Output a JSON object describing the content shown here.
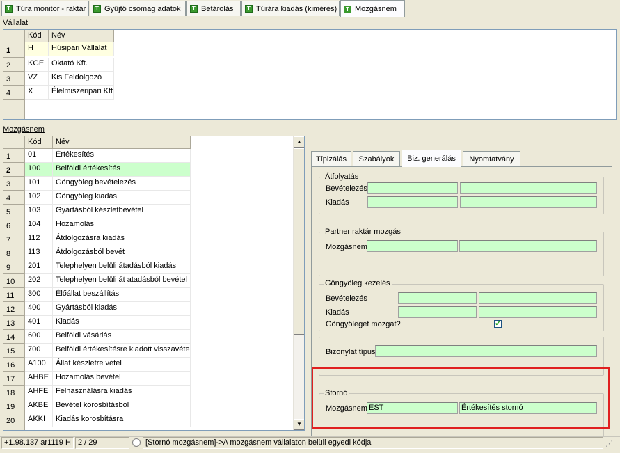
{
  "tabs": [
    {
      "label": "Túra monitor - raktár"
    },
    {
      "label": "Gyűjtő csomag adatok"
    },
    {
      "label": "Betárolás"
    },
    {
      "label": "Túrára kiadás (kimérés)"
    },
    {
      "label": "Mozgásnem"
    }
  ],
  "tab_icon_glyph": "T",
  "vallalat": {
    "label": "Vállalat",
    "headers": [
      "Kód",
      "Név"
    ],
    "rows": [
      {
        "num": "1",
        "kod": "H",
        "nev": "Húsipari Vállalat"
      },
      {
        "num": "2",
        "kod": "KGE",
        "nev": "Oktató Kft."
      },
      {
        "num": "3",
        "kod": "VZ",
        "nev": "Kis Feldolgozó"
      },
      {
        "num": "4",
        "kod": "X",
        "nev": "Élelmiszeripari Kft."
      }
    ]
  },
  "mozgasnem": {
    "label": "Mozgásnem",
    "headers": [
      "Kód",
      "Név"
    ],
    "rows": [
      {
        "num": "1",
        "kod": "01",
        "nev": "Értékesítés"
      },
      {
        "num": "2",
        "kod": "100",
        "nev": "Belföldi értékesítés"
      },
      {
        "num": "3",
        "kod": "101",
        "nev": "Göngyöleg bevételezés"
      },
      {
        "num": "4",
        "kod": "102",
        "nev": "Göngyöleg  kiadás"
      },
      {
        "num": "5",
        "kod": "103",
        "nev": "Gyártásból készletbevétel"
      },
      {
        "num": "6",
        "kod": "104",
        "nev": "Hozamolás"
      },
      {
        "num": "7",
        "kod": "112",
        "nev": "Átdolgozásra kiadás"
      },
      {
        "num": "8",
        "kod": "113",
        "nev": "Átdolgozásból bevét"
      },
      {
        "num": "9",
        "kod": "201",
        "nev": "Telephelyen belüli átadásból kiadás"
      },
      {
        "num": "10",
        "kod": "202",
        "nev": "Telephelyen belüli át atadásból bevétel"
      },
      {
        "num": "11",
        "kod": "300",
        "nev": "Élőállat beszállítás"
      },
      {
        "num": "12",
        "kod": "400",
        "nev": "Gyártásból kiadás"
      },
      {
        "num": "13",
        "kod": "401",
        "nev": "Kiadás"
      },
      {
        "num": "14",
        "kod": "600",
        "nev": "Belföldi vásárlás"
      },
      {
        "num": "15",
        "kod": "700",
        "nev": "Belföldi értékesítésre kiadott visszavétel"
      },
      {
        "num": "16",
        "kod": "A100",
        "nev": "Állat készletre vétel"
      },
      {
        "num": "17",
        "kod": "AHBE",
        "nev": "Hozamolás bevétel"
      },
      {
        "num": "18",
        "kod": "AHFE",
        "nev": "Felhasználásra kiadás"
      },
      {
        "num": "19",
        "kod": "AKBE",
        "nev": "Bevétel korosbításból"
      },
      {
        "num": "20",
        "kod": "AKKI",
        "nev": "Kiadás korosbításra"
      }
    ]
  },
  "right_tabs": [
    {
      "label": "Típizálás"
    },
    {
      "label": "Szabályok"
    },
    {
      "label": "Biz. generálás"
    },
    {
      "label": "Nyomtatvány"
    }
  ],
  "atfolyatas": {
    "title": "Átfolyatás",
    "bevetelezes_label": "Bevételezés",
    "kiadas_label": "Kiadás"
  },
  "partner": {
    "title": "Partner raktár mozgás",
    "mozgasnem_label": "Mozgásnem"
  },
  "gongyoleg": {
    "title": "Göngyöleg kezelés",
    "bevetelezes_label": "Bevételezés",
    "kiadas_label": "Kiadás",
    "mozgat_label": "Göngyöleget mozgat?",
    "mozgat_checked": true
  },
  "bizonylat": {
    "label": "Bizonylat típus"
  },
  "storno": {
    "title": "Stornó",
    "mozgasnem_label": "Mozgásnem",
    "code": "EST",
    "name": "Értékesítés stornó"
  },
  "statusbar": {
    "version": "+1.98.137 ar1119 H",
    "record": "2 / 29",
    "hint": "[Stornó mozgásnem]->A mozgásnem vállalaton belüli egyedi kódja"
  },
  "colors": {
    "field_bg": "#ccffcc",
    "selected_row": "#ccffcc",
    "highlight_box": "#e02020",
    "tab_icon": "#3a9a2e"
  },
  "icons": {
    "tab_icon": "green-t-icon",
    "scroll_up": "scroll-up-arrow-icon",
    "scroll_down": "scroll-down-arrow-icon",
    "check": "checkmark-icon"
  }
}
